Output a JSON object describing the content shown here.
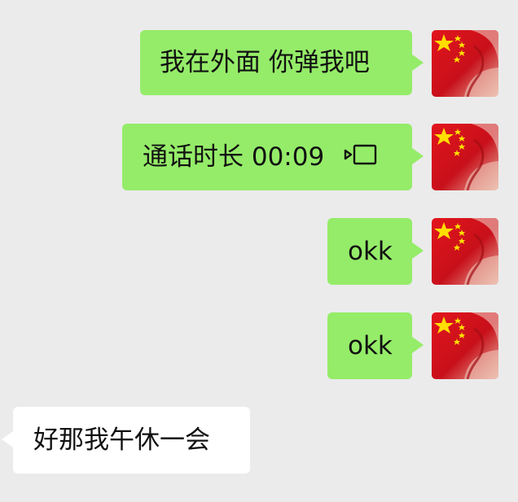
{
  "chat": {
    "messages": [
      {
        "direction": "outgoing",
        "type": "text",
        "text": "我在外面 你弹我吧",
        "avatar_icon": "china-flag-avatar-icon"
      },
      {
        "direction": "outgoing",
        "type": "call",
        "text": "通话时长 00:09",
        "call_icon": "video-call-icon",
        "avatar_icon": "china-flag-avatar-icon"
      },
      {
        "direction": "outgoing",
        "type": "text",
        "text": "okk",
        "avatar_icon": "china-flag-avatar-icon"
      },
      {
        "direction": "outgoing",
        "type": "text",
        "text": "okk",
        "avatar_icon": "china-flag-avatar-icon"
      },
      {
        "direction": "incoming",
        "type": "text",
        "text": "好那我午休一会"
      }
    ]
  },
  "colors": {
    "background": "#ebebeb",
    "outgoing_bubble": "#95ec69",
    "incoming_bubble": "#ffffff",
    "text": "#111111",
    "avatar_red": "#d8121b",
    "avatar_star": "#ffde00"
  }
}
